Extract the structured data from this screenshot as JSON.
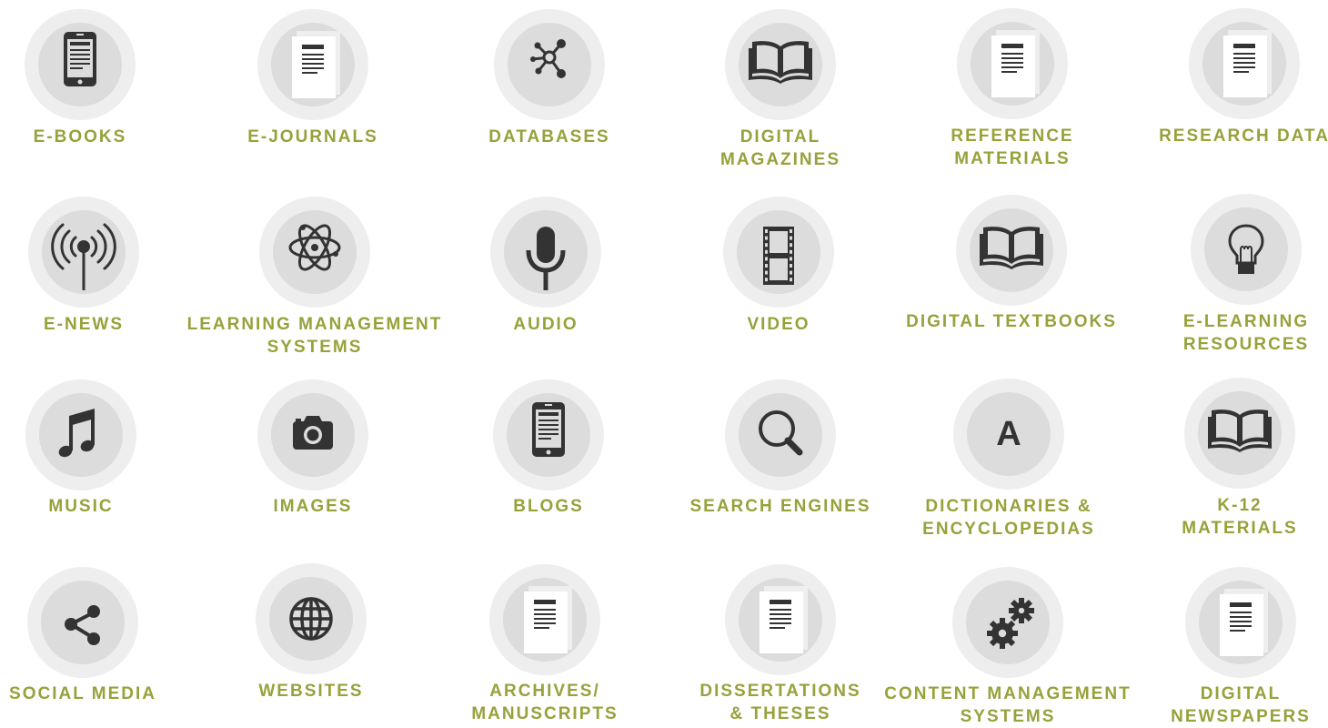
{
  "accent_color": "#98a13a",
  "icon_color": "#333333",
  "resources": [
    {
      "label": "E-BOOKS",
      "icon": "tablet-icon"
    },
    {
      "label": "E-JOURNALS",
      "icon": "document-icon"
    },
    {
      "label": "DATABASES",
      "icon": "network-icon"
    },
    {
      "label": "DIGITAL\nMAGAZINES",
      "icon": "open-book-icon"
    },
    {
      "label": "REFERENCE\nMATERIALS",
      "icon": "document-icon"
    },
    {
      "label": "RESEARCH DATA",
      "icon": "document-icon"
    },
    {
      "label": "E-NEWS",
      "icon": "broadcast-icon"
    },
    {
      "label": "LEARNING MANAGEMENT\nSYSTEMS",
      "icon": "atom-icon"
    },
    {
      "label": "AUDIO",
      "icon": "microphone-icon"
    },
    {
      "label": "VIDEO",
      "icon": "film-icon"
    },
    {
      "label": "DIGITAL TEXTBOOKS",
      "icon": "open-book-icon"
    },
    {
      "label": "E-LEARNING\nRESOURCES",
      "icon": "lightbulb-icon"
    },
    {
      "label": "MUSIC",
      "icon": "music-note-icon"
    },
    {
      "label": "IMAGES",
      "icon": "camera-icon"
    },
    {
      "label": "BLOGS",
      "icon": "tablet-icon"
    },
    {
      "label": "SEARCH ENGINES",
      "icon": "magnifier-icon"
    },
    {
      "label": "DICTIONARIES &\nENCYCLOPEDIAS",
      "icon": "letter-a-icon",
      "glyph": "A"
    },
    {
      "label": "K-12\nMATERIALS",
      "icon": "open-book-icon"
    },
    {
      "label": "SOCIAL MEDIA",
      "icon": "share-icon"
    },
    {
      "label": "WEBSITES",
      "icon": "globe-icon"
    },
    {
      "label": "ARCHIVES/\nMANUSCRIPTS",
      "icon": "document-icon"
    },
    {
      "label": "DISSERTATIONS\n& THESES",
      "icon": "document-icon"
    },
    {
      "label": "CONTENT MANAGEMENT\nSYSTEMS",
      "icon": "gears-icon"
    },
    {
      "label": "DIGITAL\nNEWSPAPERS",
      "icon": "document-icon"
    }
  ]
}
